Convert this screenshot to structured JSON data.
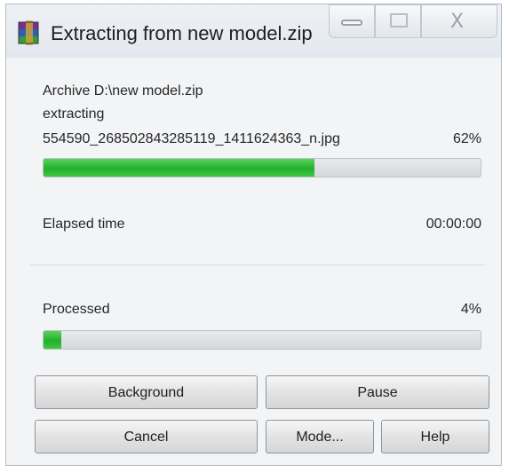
{
  "window": {
    "title": "Extracting from new model.zip",
    "icon": "winrar-archive-icon"
  },
  "titlebar_buttons": {
    "minimize_icon": "minimize-icon",
    "maximize_icon": "maximize-icon",
    "close_glyph": "X"
  },
  "progress": {
    "archive_label": "Archive D:\\new model.zip",
    "action_label": "extracting",
    "current_file": "554590_268502843285119_1411624363_n.jpg",
    "file_percent_text": "62%",
    "file_fraction": 0.62,
    "elapsed_label": "Elapsed time",
    "elapsed_value": "00:00:00",
    "processed_label": "Processed",
    "processed_percent_text": "4%",
    "processed_fraction": 0.04
  },
  "buttons": {
    "background": "Background",
    "pause": "Pause",
    "cancel": "Cancel",
    "mode": "Mode...",
    "help": "Help"
  },
  "colors": {
    "progress_green": "#23b02c",
    "window_bg": "#f3f4f6"
  }
}
